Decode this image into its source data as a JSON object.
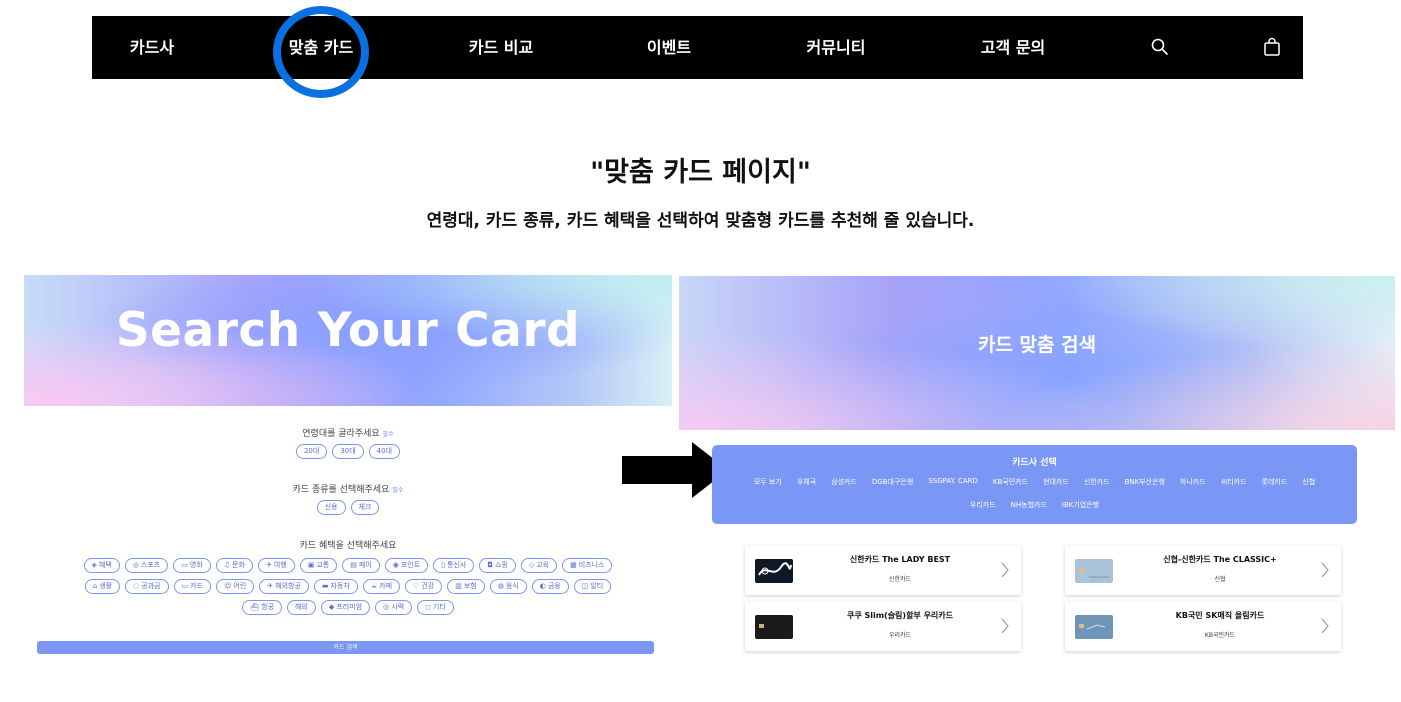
{
  "nav": {
    "items": [
      "카드사",
      "맞춤 카드",
      "카드 비교",
      "이벤트",
      "커뮤니티",
      "고객 문의"
    ],
    "highlighted": "맞춤 카드",
    "icons": [
      "search-icon",
      "shopping-bag-icon"
    ]
  },
  "heading": {
    "title": "\"맞춤 카드 페이지\"",
    "subtitle": "연령대, 카드 종류, 카드 혜택을 선택하여 맞춤형 카드를 추천해 줄 있습니다."
  },
  "left_panel": {
    "banner_title": "Search Your Card",
    "age": {
      "label": "연령대를 골라주세요",
      "required": "필수",
      "options": [
        "20대",
        "30대",
        "40대"
      ]
    },
    "type": {
      "label": "카드 종류를 선택해주세요",
      "required": "필수",
      "options": [
        "신용",
        "체크"
      ]
    },
    "benefit": {
      "label": "카드 혜택을 선택해주세요",
      "rows": [
        [
          {
            "icon": "tag-icon",
            "text": "혜택"
          },
          {
            "icon": "sports-icon",
            "text": "스포츠"
          },
          {
            "icon": "movie-icon",
            "text": "영화"
          },
          {
            "icon": "culture-icon",
            "text": "문화"
          },
          {
            "icon": "travel-icon",
            "text": "여행"
          },
          {
            "icon": "transport-icon",
            "text": "교통"
          },
          {
            "icon": "pay-icon",
            "text": "페이"
          },
          {
            "icon": "point-icon",
            "text": "포인트"
          },
          {
            "icon": "phone-icon",
            "text": "통신사"
          },
          {
            "icon": "shopping-icon",
            "text": "쇼핑"
          },
          {
            "icon": "education-icon",
            "text": "교육"
          },
          {
            "icon": "business-icon",
            "text": "비즈니스"
          }
        ],
        [
          {
            "icon": "home-icon",
            "text": "생활"
          },
          {
            "icon": "utility-icon",
            "text": "공과금"
          },
          {
            "icon": "card-icon",
            "text": "카드"
          },
          {
            "icon": "baby-icon",
            "text": "어린"
          },
          {
            "icon": "airline-icon",
            "text": "해외항공"
          },
          {
            "icon": "car-icon",
            "text": "자동차"
          },
          {
            "icon": "cafe-icon",
            "text": "카페"
          },
          {
            "icon": "health-icon",
            "text": "건강"
          },
          {
            "icon": "insurance-icon",
            "text": "보험"
          },
          {
            "icon": "food-icon",
            "text": "음식"
          },
          {
            "icon": "finance-icon",
            "text": "금융"
          },
          {
            "icon": "etc-icon",
            "text": "알티"
          }
        ],
        [
          {
            "icon": "ship-icon",
            "text": "항공"
          },
          {
            "icon": "",
            "text": "해외"
          },
          {
            "icon": "premium-icon",
            "text": "프리미엄"
          },
          {
            "icon": "lounge-icon",
            "text": "시력"
          },
          {
            "icon": "more-icon",
            "text": "기타"
          }
        ]
      ]
    },
    "search_button": "카드 검색"
  },
  "right_panel": {
    "banner_title": "카드 맞춤 검색",
    "issuer": {
      "title": "카드사 선택",
      "row1": [
        "모두 보기",
        "우체국",
        "삼성카드",
        "DGB대구은행",
        "SSGPAY. CARD",
        "KB국민카드",
        "현대카드",
        "신한카드",
        "BNK부산은행",
        "하나카드",
        "씨티카드",
        "롯데카드",
        "신협"
      ],
      "row2": [
        "우리카드",
        "NH농협카드",
        "IBK기업은행"
      ]
    },
    "cards": [
      {
        "name": "신한카드 The LADY BEST",
        "issuer": "신한카드",
        "thumb_color": "#101828"
      },
      {
        "name": "신협-신한카드 The CLASSIC+",
        "issuer": "신협",
        "thumb_color": "#a9c4d8"
      },
      {
        "name": "쿠쿠 Slim(슬림)할부 우리카드",
        "issuer": "우리카드",
        "thumb_color": "#1b1b1b"
      },
      {
        "name": "KB국민 SK매직 올림카드",
        "issuer": "KB국민카드",
        "thumb_color": "#6f96b8"
      }
    ]
  },
  "colors": {
    "accent": "#7a97f5",
    "ring": "#0a6fe0",
    "nav_bg": "#000000"
  }
}
